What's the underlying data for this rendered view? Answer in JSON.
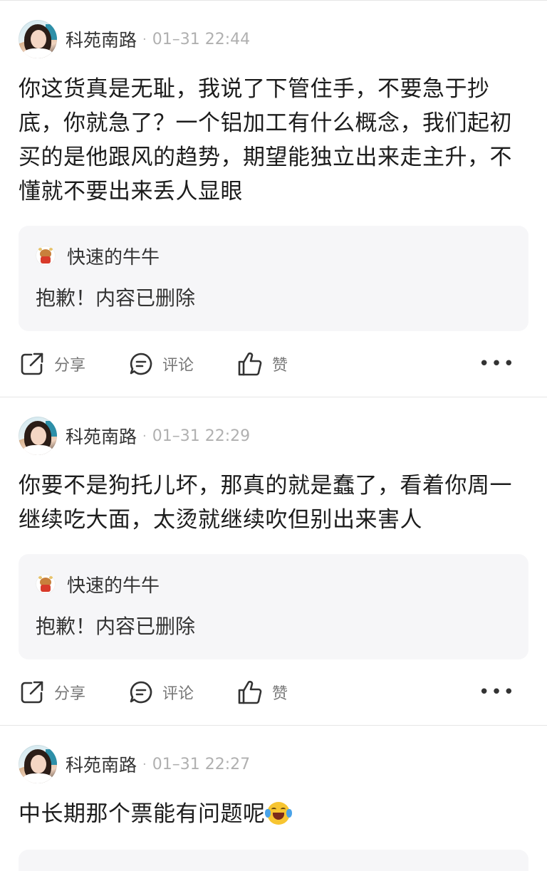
{
  "posts": [
    {
      "username": "科苑南路",
      "separator": "·",
      "timestamp": "01–31 22:44",
      "body": "你这货真是无耻，我说了下管住手，不要急于抄底，你就急了？一个铝加工有什么概念，我们起初买的是他跟风的趋势，期望能独立出来走主升，不懂就不要出来丢人显眼",
      "quote": {
        "author": "快速的牛牛",
        "text": "抱歉！内容已删除"
      },
      "actions": {
        "share": "分享",
        "comment": "评论",
        "like": "赞",
        "more": "•••"
      }
    },
    {
      "username": "科苑南路",
      "separator": "·",
      "timestamp": "01–31 22:29",
      "body": "你要不是狗托儿坏，那真的就是蠢了，看着你周一继续吃大面，太烫就继续吹但别出来害人",
      "quote": {
        "author": "快速的牛牛",
        "text": "抱歉！内容已删除"
      },
      "actions": {
        "share": "分享",
        "comment": "评论",
        "like": "赞",
        "more": "•••"
      }
    },
    {
      "username": "科苑南路",
      "separator": "·",
      "timestamp": "01–31 22:27",
      "body": "中长期那个票能有问题呢",
      "body_emoji": "laughing-crying-emoji"
    }
  ],
  "icons": {
    "share": "share-icon",
    "comment": "comment-icon",
    "like": "thumbs-up-icon",
    "more": "more-icon"
  }
}
